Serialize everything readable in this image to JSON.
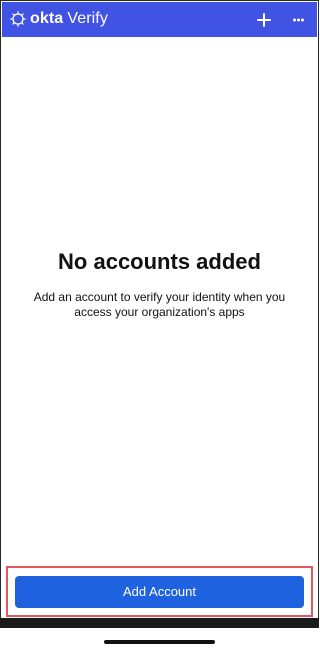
{
  "header": {
    "brand_okta": "okta",
    "brand_verify": "Verify",
    "logo_icon": "okta-logo-icon",
    "add_icon": "plus-icon",
    "more_icon": "more-horizontal-icon",
    "bg_color": "#4053e3"
  },
  "empty_state": {
    "title": "No accounts added",
    "subtitle": "Add an account to verify your identity when you access your organization's apps"
  },
  "footer": {
    "add_account_label": "Add Account",
    "button_color": "#1f62e0",
    "highlight_color": "#e0595f"
  }
}
